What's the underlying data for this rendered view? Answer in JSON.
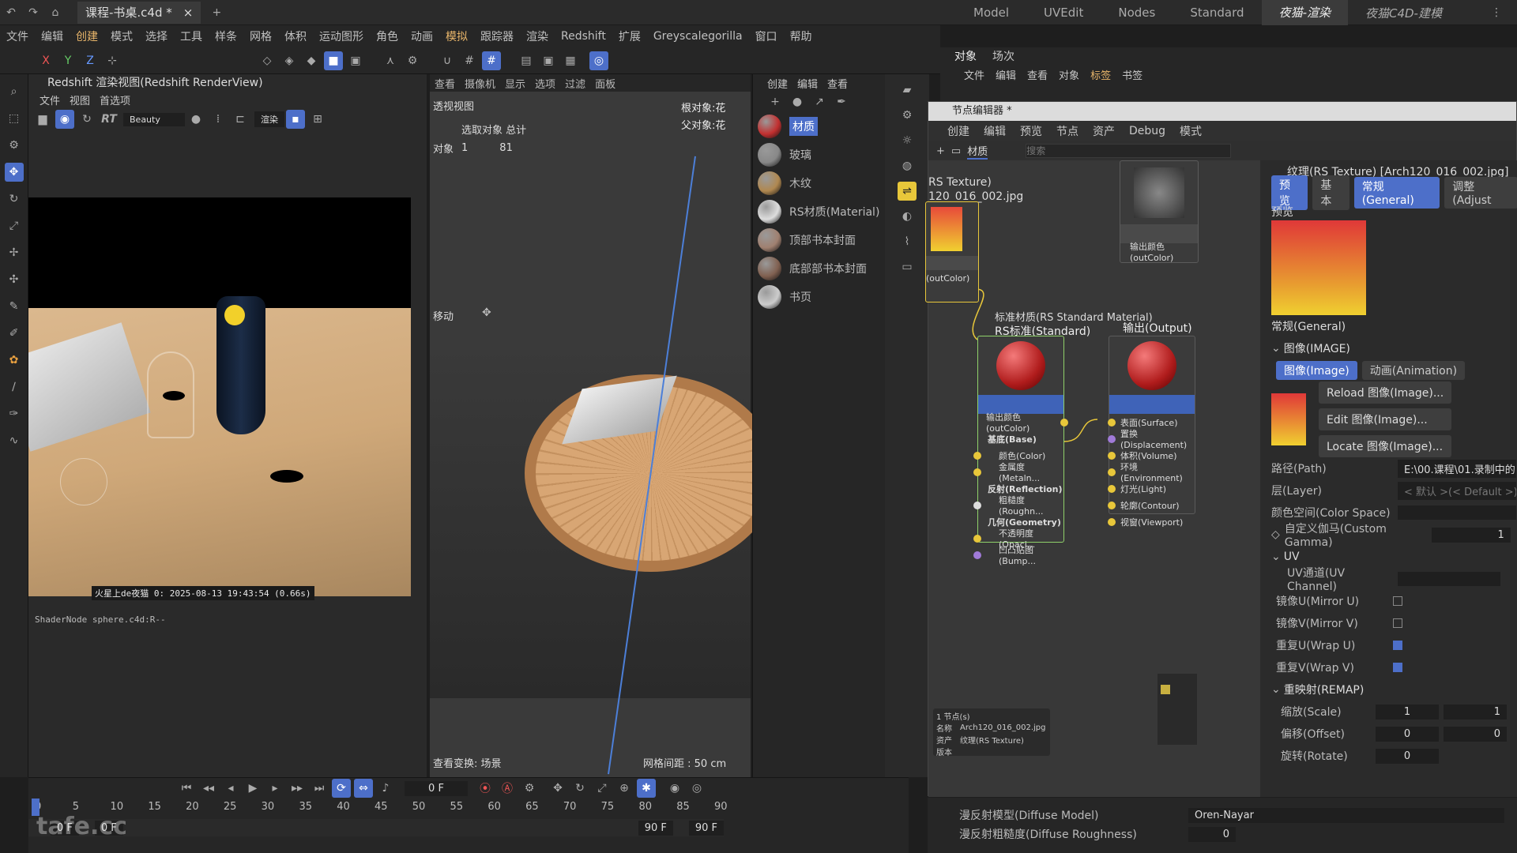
{
  "topbar": {
    "doc_tab": "课程-书桌.c4d *",
    "layouts": [
      "Model",
      "UVEdit",
      "Nodes",
      "Standard",
      "夜猫-渲染",
      "夜猫C4D-建模"
    ]
  },
  "menu": [
    "文件",
    "编辑",
    "创建",
    "模式",
    "选择",
    "工具",
    "样条",
    "网格",
    "体积",
    "运动图形",
    "角色",
    "动画",
    "模拟",
    "跟踪器",
    "渲染",
    "Redshift",
    "扩展",
    "Greyscalegorilla",
    "窗口",
    "帮助"
  ],
  "toolbar_axes": [
    "X",
    "Y",
    "Z"
  ],
  "renderview": {
    "title": "Redshift 渲染视图(Redshift RenderView)",
    "menu": [
      "文件",
      "视图",
      "首选项"
    ],
    "aov": "Beauty",
    "rt_label": "RT",
    "mode_label": "渲染",
    "status": "火星上de夜猫  0:  2025-08-13  19:43:54  (0.66s)",
    "shader_node": "ShaderNode sphere.c4d:R--"
  },
  "viewport": {
    "menu": [
      "查看",
      "摄像机",
      "显示",
      "选项",
      "过滤",
      "面板"
    ],
    "name": "透视视图",
    "stats_header": "选取对象 总计",
    "stats_label": "对象",
    "stats_sel": "1",
    "stats_total": "81",
    "root_obj": "根对象:花",
    "parent_obj": "父对象:花",
    "move_label": "移动",
    "view_transform": "查看变换: 场景",
    "grid_spacing": "网格间距 : 50 cm"
  },
  "matpanel": {
    "menu": [
      "创建",
      "编辑",
      "查看"
    ],
    "materials": [
      {
        "name": "材质",
        "color": "#c23030"
      },
      {
        "name": "玻璃",
        "color": "#888888"
      },
      {
        "name": "木纹",
        "color": "#b08850"
      },
      {
        "name": "RS材质(Material)",
        "color": "#dddddd"
      },
      {
        "name": "顶部书本封面",
        "color": "#a08070"
      },
      {
        "name": "底部部书本封面",
        "color": "#806050"
      },
      {
        "name": "书页",
        "color": "#cccccc"
      }
    ]
  },
  "objpanel": {
    "tabs": [
      "对象",
      "场次"
    ],
    "menu": [
      "文件",
      "编辑",
      "查看",
      "对象",
      "标签",
      "书签"
    ]
  },
  "nodeeditor": {
    "title": "节点编辑器 *",
    "menu": [
      "创建",
      "编辑",
      "预览",
      "节点",
      "资产",
      "Debug",
      "模式"
    ],
    "crumb": "材质",
    "search_placeholder": "搜索",
    "tex_node_title": "RS Texture)",
    "tex_node_file": "120_016_002.jpg",
    "tex_out": "(outColor)",
    "top_node_out": "输出颜色(outColor)",
    "std_node_type": "标准材质(RS Standard Material)",
    "std_node_title": "RS标准(Standard)",
    "std_ports": [
      "输出颜色(outColor)",
      "基底(Base)",
      "颜色(Color)",
      "金属度(Metaln...",
      "反射(Reflection)",
      "粗糙度(Roughn...",
      "几何(Geometry)",
      "不透明度(Opaci...",
      "凹凸贴图(Bump..."
    ],
    "out_node_title": "输出(Output)",
    "out_ports": [
      "表面(Surface)",
      "置换(Displacement)",
      "体积(Volume)",
      "环境(Environment)",
      "灯光(Light)",
      "轮廓(Contour)",
      "视窗(Viewport)"
    ],
    "info": {
      "count": "1 节点(s)",
      "name_label": "名称",
      "name_val": "Arch120_016_002.jpg",
      "asset_label": "资产",
      "asset_val": "纹理(RS Texture)",
      "ver_label": "版本"
    }
  },
  "attributes": {
    "title": "纹理(RS Texture) [Arch120_016_002.jpg]",
    "tabs": [
      "预览",
      "基本",
      "常规(General)",
      "调整(Adjust"
    ],
    "preview_label": "预览",
    "general": "常规(General)",
    "image_group": "图像(IMAGE)",
    "image_tabs": [
      "图像(Image)",
      "动画(Animation)"
    ],
    "buttons": [
      "Reload 图像(Image)...",
      "Edit 图像(Image)...",
      "Locate 图像(Image)..."
    ],
    "path_label": "路径(Path)",
    "path_val": "E:\\00.课程\\01.录制中的",
    "layer_label": "层(Layer)",
    "layer_val": "< 默认 >(< Default >)",
    "colorspace_label": "颜色空间(Color Space)",
    "gamma_label": "自定义伽马(Custom Gamma)",
    "gamma_val": "1",
    "uv_group": "UV",
    "uv_channel": "UV通道(UV Channel)",
    "mirror_u": "镜像U(Mirror U)",
    "mirror_v": "镜像V(Mirror V)",
    "wrap_u": "重复U(Wrap U)",
    "wrap_v": "重复V(Wrap V)",
    "remap_group": "重映射(REMAP)",
    "scale_label": "缩放(Scale)",
    "scale_vals": [
      "1",
      "1"
    ],
    "offset_label": "偏移(Offset)",
    "offset_vals": [
      "0",
      "0"
    ],
    "rotate_label": "旋转(Rotate)",
    "rotate_val": "0",
    "diffuse_model_label": "漫反射模型(Diffuse Model)",
    "diffuse_model_val": "Oren-Nayar",
    "diffuse_rough_label": "漫反射粗糙度(Diffuse Roughness)",
    "diffuse_rough_val": "0"
  },
  "timeline": {
    "frame": "0 F",
    "ticks": [
      "0",
      "5",
      "10",
      "15",
      "20",
      "25",
      "30",
      "35",
      "40",
      "45",
      "50",
      "55",
      "60",
      "65",
      "70",
      "75",
      "80",
      "85",
      "90"
    ],
    "start": "0 F",
    "start2": "0 F",
    "end": "90 F",
    "end2": "90 F"
  },
  "watermark": "tafe.cc",
  "colors": {
    "accent": "#4d6fc9",
    "node_header": "#3f63b8",
    "port_yellow": "#e8c73a",
    "port_purple": "#a07ad8"
  }
}
